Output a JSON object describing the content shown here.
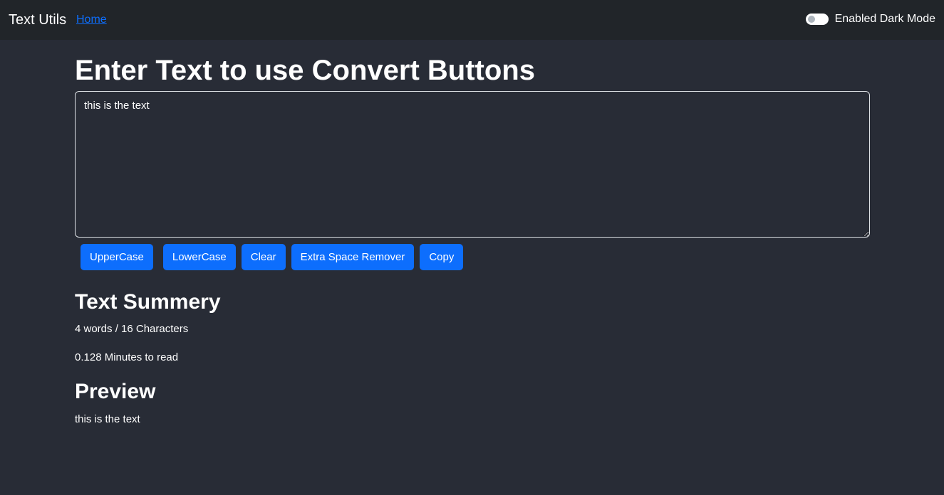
{
  "navbar": {
    "brand": "Text Utils",
    "home_link": "Home",
    "dark_mode_label": "Enabled Dark Mode"
  },
  "main": {
    "title": "Enter Text to use Convert Buttons",
    "textarea_value": "this is the text",
    "buttons": {
      "uppercase": "UpperCase",
      "lowercase": "LowerCase",
      "clear": "Clear",
      "extra_space": "Extra Space Remover",
      "copy": "Copy"
    },
    "summary": {
      "title": "Text Summery",
      "words_chars": "4 words / 16 Characters",
      "read_time": "0.128 Minutes to read"
    },
    "preview": {
      "title": "Preview",
      "text": "this is the text"
    }
  },
  "colors": {
    "background": "#282c36",
    "navbar": "#212529",
    "accent": "#0d6efd"
  }
}
